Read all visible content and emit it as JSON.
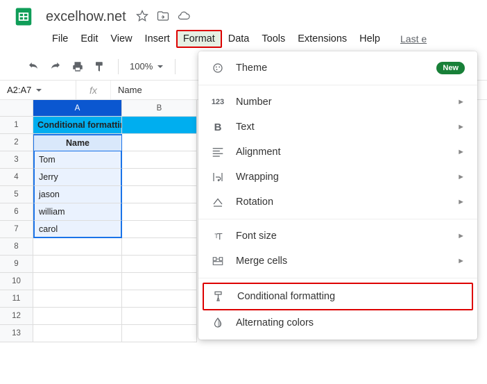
{
  "doc": {
    "title": "excelhow.net"
  },
  "menu": {
    "items": [
      "File",
      "Edit",
      "View",
      "Insert",
      "Format",
      "Data",
      "Tools",
      "Extensions",
      "Help"
    ],
    "active_index": 4,
    "last_edit": "Last e"
  },
  "toolbar": {
    "zoom": "100%"
  },
  "fxbar": {
    "namebox": "A2:A7",
    "formula": "Name",
    "fx_label": "fx"
  },
  "columns": [
    "A",
    "B"
  ],
  "rows": [
    1,
    2,
    3,
    4,
    5,
    6,
    7,
    8,
    9,
    10,
    11,
    12,
    13
  ],
  "cells": {
    "r1_a": "Conditional formatting based o",
    "r2_a": "Name",
    "r3_a": "Tom",
    "r4_a": "Jerry",
    "r5_a": "jason",
    "r6_a": "william",
    "r7_a": "carol"
  },
  "dropdown": {
    "theme": "Theme",
    "new_badge": "New",
    "number": "Number",
    "text": "Text",
    "alignment": "Alignment",
    "wrapping": "Wrapping",
    "rotation": "Rotation",
    "fontsize": "Font size",
    "mergecells": "Merge cells",
    "conditional": "Conditional formatting",
    "alternating": "Alternating colors"
  }
}
